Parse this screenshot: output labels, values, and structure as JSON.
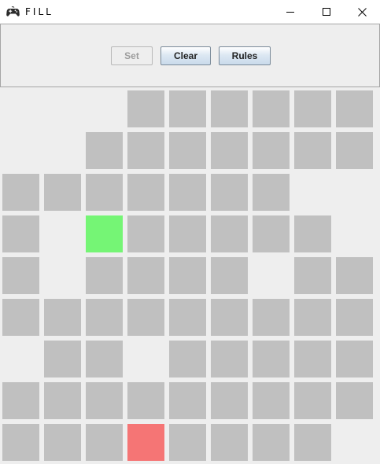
{
  "window": {
    "title": "FILL",
    "app_icon": "gamepad-icon",
    "controls": [
      "minimize-icon",
      "maximize-icon",
      "close-icon"
    ]
  },
  "toolbar": {
    "set_label": "Set",
    "set_enabled": false,
    "clear_label": "Clear",
    "rules_label": "Rules"
  },
  "board": {
    "rows": 9,
    "cols": 9,
    "colors": {
      "filled": "#c0c0c0",
      "start": "#75f575",
      "end": "#f57575"
    },
    "layout": [
      "...######",
      "..#######",
      "#######..",
      "#.S#####.",
      "#.####.##",
      "#########",
      ".##.#####",
      "#########",
      "###E####."
    ]
  }
}
